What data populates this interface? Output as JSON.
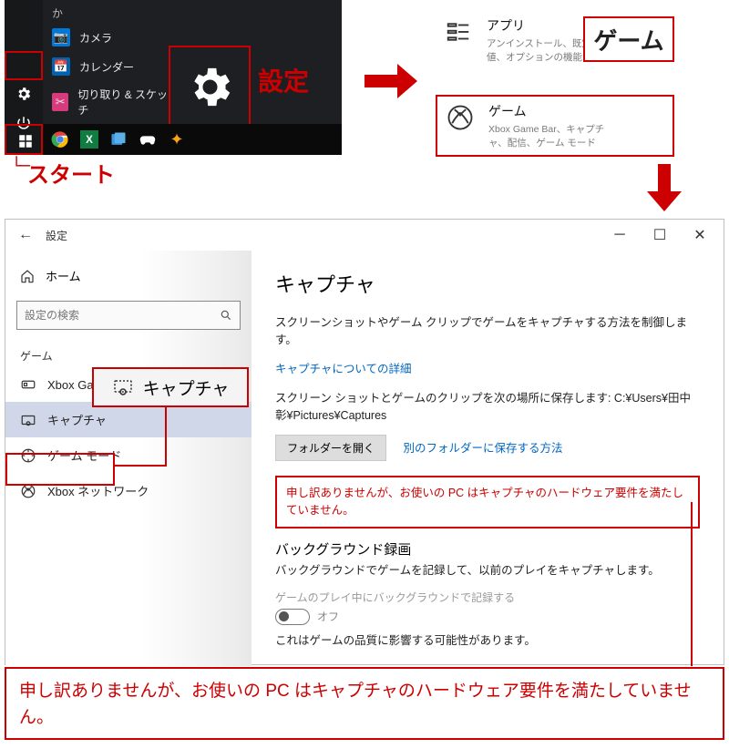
{
  "start_menu": {
    "letter": "か",
    "items": [
      {
        "label": "カメラ",
        "color": "#0078d7"
      },
      {
        "label": "カレンダー",
        "color": "#0063b1"
      },
      {
        "label": "切り取り & スケッチ",
        "color": "#d83b7d"
      }
    ]
  },
  "annotations": {
    "settings": "設定",
    "start": "スタート",
    "gaming_callout": "ゲーム"
  },
  "categories": {
    "apps": {
      "title": "アプリ",
      "desc": "アンインストール、既定値、オプションの機能"
    },
    "gaming": {
      "title": "ゲーム",
      "desc": "Xbox Game Bar、キャプチャ、配信、ゲーム モード"
    }
  },
  "settings_window": {
    "title": "設定",
    "home": "ホーム",
    "search_placeholder": "設定の検索",
    "section": "ゲーム",
    "items": {
      "xbox_bar": "Xbox Game Bar",
      "capture": "キャプチャ",
      "game_mode": "ゲーム モード",
      "xbox_net": "Xbox ネットワーク"
    },
    "capture_callout": "キャプチャ"
  },
  "content": {
    "heading": "キャプチャ",
    "intro": "スクリーンショットやゲーム クリップでゲームをキャプチャする方法を制御します。",
    "learn_more": "キャプチャについての詳細",
    "save_location": "スクリーン ショットとゲームのクリップを次の場所に保存します: C:¥Users¥田中彰¥Pictures¥Captures",
    "open_folder": "フォルダーを開く",
    "other_folder": "別のフォルダーに保存する方法",
    "error": "申し訳ありませんが、お使いの PC はキャプチャのハードウェア要件を満たしていません。",
    "bg_heading": "バックグラウンド録画",
    "bg_desc": "バックグラウンドでゲームを記録して、以前のプレイをキャプチャします。",
    "bg_toggle_label": "ゲームのプレイ中にバックグラウンドで記録する",
    "toggle_state": "オフ",
    "bg_warning": "これはゲームの品質に影響する可能性があります。"
  },
  "bottom_note": "申し訳ありませんが、お使いの PC はキャプチャのハードウェア要件を満たしていません。"
}
